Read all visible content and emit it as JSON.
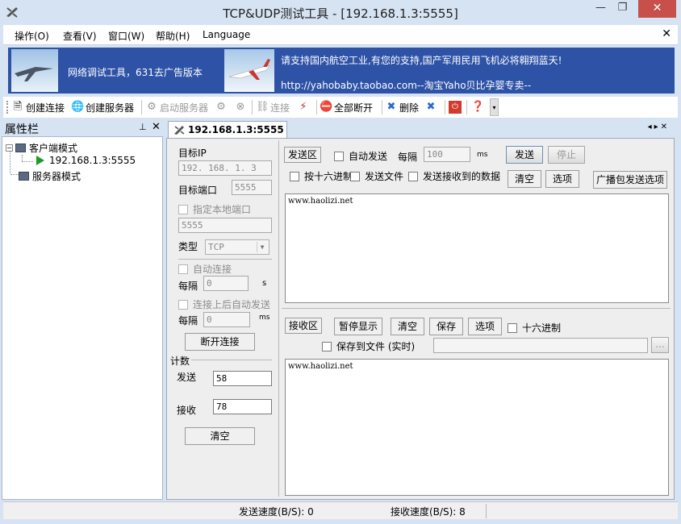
{
  "window": {
    "title": "TCP&UDP测试工具 - [192.168.1.3:5555]",
    "min_glyph": "—",
    "max_glyph": "❐",
    "close_glyph": "✕"
  },
  "menu": {
    "items": [
      "操作(O)",
      "查看(V)",
      "窗口(W)",
      "帮助(H)",
      "Language"
    ],
    "close_glyph": "✕"
  },
  "banner": {
    "left_text": "网络调试工具，631去广告版本",
    "line1": "请支持国内航空工业,有您的支持,国产军用民用飞机必将翱翔蓝天!",
    "line2": "http://yahobaby.taobao.com--淘宝Yaho贝比孕婴专卖--"
  },
  "toolbar": {
    "create_connection": "创建连接",
    "create_server": "创建服务器",
    "start_server": "启动服务器",
    "connect": "连接",
    "disconnect_all": "全部断开",
    "delete": "删除"
  },
  "property_panel": {
    "title": "属性栏",
    "pin_glyph": "⊥",
    "close_glyph": "✕",
    "tree": {
      "client_mode": "客户端模式",
      "client_entry": "192.168.1.3:5555",
      "server_mode": "服务器模式"
    }
  },
  "tab": {
    "label": "192.168.1.3:5555",
    "nav": "◂▸✕"
  },
  "connection": {
    "target_ip_label": "目标IP",
    "target_ip": "192. 168. 1. 3",
    "target_port_label": "目标端口",
    "target_port": "5555",
    "local_port_check": "指定本地端口",
    "local_port": "5555",
    "type_label": "类型",
    "type_value": "TCP",
    "auto_connect_check": "自动连接",
    "interval_label": "每隔",
    "interval_value": "0",
    "interval_unit": "s",
    "auto_send_check": "连接上后自动发送",
    "interval2_label": "每隔",
    "interval2_value": "0",
    "interval2_unit": "ms",
    "disconnect_button": "断开连接",
    "count_label": "计数",
    "send_label": "发送",
    "send_count": "58",
    "recv_label": "接收",
    "recv_count": "78",
    "clear_button": "清空"
  },
  "send_area": {
    "label": "发送区",
    "auto_send_check": "自动发送",
    "interval_label": "每隔",
    "interval_value": "100",
    "interval_unit": "ms",
    "send_button": "发送",
    "stop_button": "停止",
    "hex_check": "按十六进制",
    "send_file_check": "发送文件",
    "send_received_check": "发送接收到的数据",
    "clear_button": "清空",
    "options_button": "选项",
    "broadcast_button": "广播包发送选项",
    "content": "www.haolizi.net"
  },
  "recv_area": {
    "label": "接收区",
    "pause_button": "暂停显示",
    "clear_button": "清空",
    "save_button": "保存",
    "options_button": "选项",
    "hex_check": "十六进制",
    "save_to_file_check": "保存到文件 (实时)",
    "browse_button": "...",
    "content": "www.haolizi.net"
  },
  "status": {
    "send_speed": "发送速度(B/S): 0",
    "recv_speed": "接收速度(B/S): 8"
  }
}
